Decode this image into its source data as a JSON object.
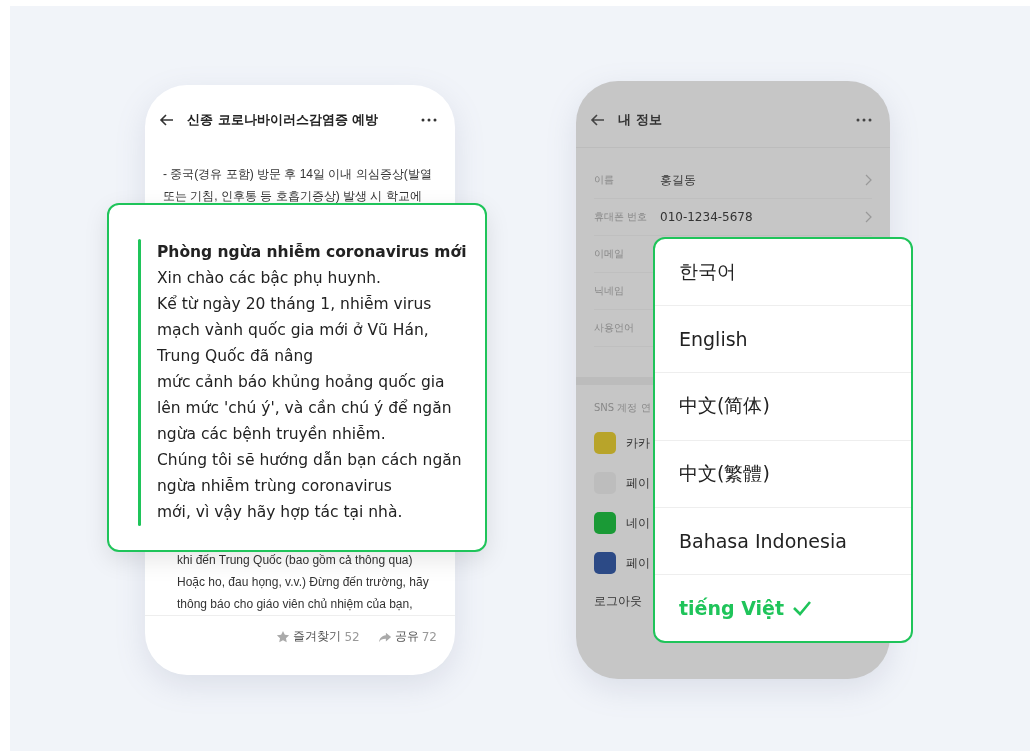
{
  "article_screen": {
    "title": "신종 코로나바이러스감염증 예방",
    "body_lines_top": [
      "- 중국(경유 포함) 방문 후 14일 이내 의심증상(발열",
      "또는 기침, 인후통 등 호흡기증상) 발생 시 학교에"
    ],
    "body_lines_bottom": [
      "khi đến Trung Quốc (bao gồm cả thông qua)",
      "Hoặc ho, đau họng, v.v.) Đừng đến trường, hãy",
      "thông báo cho giáo viên chủ nhiệm của bạn,"
    ],
    "bookmark": {
      "label": "즐겨찾기",
      "count": "52"
    },
    "share": {
      "label": "공유",
      "count": "72"
    }
  },
  "translation_card": {
    "heading": "Phòng ngừa nhiễm coronavirus mới",
    "lines": [
      "Xin chào các bậc phụ huynh.",
      "Kể từ ngày 20 tháng 1, nhiễm virus",
      "mạch vành quốc gia mới ở Vũ Hán,",
      "Trung Quốc đã nâng",
      "mức cảnh báo khủng hoảng quốc gia",
      "lên mức 'chú ý', và cần chú ý để ngăn",
      "ngừa các bệnh truyền nhiễm.",
      "Chúng tôi sẽ hướng dẫn bạn cách ngăn",
      "ngừa nhiễm trùng coronavirus",
      "mới, vì vậy hãy hợp tác tại nhà."
    ]
  },
  "profile_screen": {
    "title": "내 정보",
    "fields": [
      {
        "label": "이름",
        "value": "홍길동"
      },
      {
        "label": "휴대폰 번호",
        "value": "010-1234-5678"
      },
      {
        "label": "이메일"
      },
      {
        "label": "닉네임"
      },
      {
        "label": "사용언어"
      }
    ],
    "sns_heading": "SNS 계정 연",
    "sns_accounts": [
      {
        "kind": "kakao",
        "name": "카카"
      },
      {
        "kind": "payco",
        "name": "페이"
      },
      {
        "kind": "naver",
        "name": "네이"
      },
      {
        "kind": "facebook",
        "name": "페이"
      }
    ],
    "logout": "로그아웃"
  },
  "language_menu": {
    "options": [
      {
        "label": "한국어",
        "selected": false
      },
      {
        "label": "English",
        "selected": false
      },
      {
        "label": "中文(简体)",
        "selected": false
      },
      {
        "label": "中文(繁體)",
        "selected": false
      },
      {
        "label": "Bahasa Indonesia",
        "selected": false
      },
      {
        "label": "tiếng Việt",
        "selected": true
      }
    ]
  }
}
